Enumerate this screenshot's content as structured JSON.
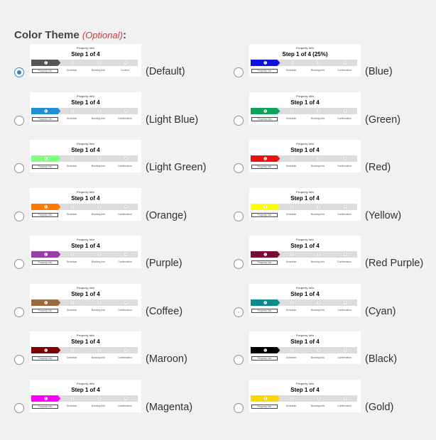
{
  "section": {
    "label": "Color Theme",
    "optional": "(Optional)",
    "colon": ":"
  },
  "preview": {
    "subtitle": "Property Info",
    "step_text": "Step 1 of 4",
    "step_text_blue": "Step 1 of 4 (25%)",
    "step_labels": [
      "Property Info",
      "Schedule",
      "Booking Info",
      "Confirmation"
    ],
    "step_labels_default": [
      "Property Info",
      "Schedule",
      "Booking Info",
      "Confirm"
    ],
    "step_numbers": [
      "1",
      "2",
      "3",
      "4"
    ]
  },
  "selected": "Default",
  "themes": [
    {
      "name": "(Default)",
      "color": "#555555"
    },
    {
      "name": "(Blue)",
      "color": "#1010d8"
    },
    {
      "name": "(Light Blue)",
      "color": "#1e90d8"
    },
    {
      "name": "(Green)",
      "color": "#0aa55a"
    },
    {
      "name": "(Light Green)",
      "color": "#80ff80"
    },
    {
      "name": "(Red)",
      "color": "#ee1111"
    },
    {
      "name": "(Orange)",
      "color": "#ff7a00"
    },
    {
      "name": "(Yellow)",
      "color": "#ffff00"
    },
    {
      "name": "(Purple)",
      "color": "#9b3da9"
    },
    {
      "name": "(Red Purple)",
      "color": "#7a0a36"
    },
    {
      "name": "(Coffee)",
      "color": "#9a6b3e"
    },
    {
      "name": "(Cyan)",
      "color": "#0a8a8a"
    },
    {
      "name": "(Maroon)",
      "color": "#800000"
    },
    {
      "name": "(Black)",
      "color": "#000000"
    },
    {
      "name": "(Magenta)",
      "color": "#ff00ff"
    },
    {
      "name": "(Gold)",
      "color": "#ffd700"
    }
  ]
}
